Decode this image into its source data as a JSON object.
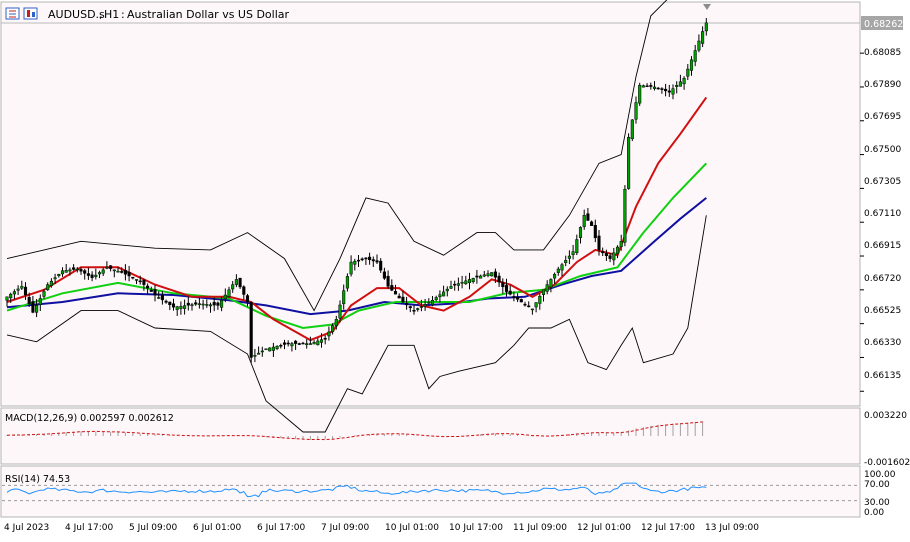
{
  "header": {
    "symbol": "AUDUSD.s",
    "timeframe": "H1",
    "description": "Australian Dollar vs US Dollar"
  },
  "colors": {
    "panel_bg": "#fdf7fa",
    "candle_up": "#00a000",
    "candle_down": "#000000",
    "bollinger": "#000000",
    "ma_fast": "#d01010",
    "ma_mid": "#10d010",
    "ma_slow": "#1010a0",
    "macd_hist": "#a0a0a0",
    "macd_signal": "#d01010",
    "rsi_line": "#1e90ff",
    "price_tag_bg": "#a6a6a6"
  },
  "icons": [
    "bars-chart-icon",
    "candles-chart-icon"
  ],
  "price_axis": {
    "current_price": "0.68262",
    "ticks": [
      "0.68085",
      "0.67890",
      "0.67695",
      "0.67500",
      "0.67305",
      "0.67110",
      "0.66915",
      "0.66720",
      "0.66525",
      "0.66330",
      "0.66135"
    ]
  },
  "time_axis": {
    "labels": [
      "4 Jul 2023",
      "4 Jul 17:00",
      "5 Jul 09:00",
      "6 Jul 01:00",
      "6 Jul 17:00",
      "7 Jul 09:00",
      "10 Jul 01:00",
      "10 Jul 17:00",
      "11 Jul 09:00",
      "12 Jul 01:00",
      "12 Jul 17:00",
      "13 Jul 09:00"
    ]
  },
  "macd": {
    "label": "MACD(12,26,9) 0.002597 0.002612",
    "ticks": [
      "0.003220",
      "-0.001602"
    ]
  },
  "rsi": {
    "label": "RSI(14) 74.53",
    "ticks": [
      "100.00",
      "70.00",
      "30.00",
      "0.00"
    ]
  },
  "chart_data": {
    "type": "candlestick",
    "ylim": [
      0.6605,
      0.6838
    ],
    "price_waypoints": [
      [
        0,
        0.6668
      ],
      [
        4,
        0.6674
      ],
      [
        7,
        0.6659
      ],
      [
        11,
        0.6675
      ],
      [
        15,
        0.6683
      ],
      [
        19,
        0.6684
      ],
      [
        23,
        0.6679
      ],
      [
        27,
        0.6685
      ],
      [
        31,
        0.6682
      ],
      [
        36,
        0.6677
      ],
      [
        40,
        0.6669
      ],
      [
        45,
        0.6662
      ],
      [
        52,
        0.6664
      ],
      [
        57,
        0.6663
      ],
      [
        62,
        0.6678
      ],
      [
        65,
        0.6665
      ],
      [
        66,
        0.6633
      ],
      [
        70,
        0.6638
      ],
      [
        76,
        0.6641
      ],
      [
        82,
        0.6641
      ],
      [
        86,
        0.6644
      ],
      [
        89,
        0.6655
      ],
      [
        93,
        0.6688
      ],
      [
        97,
        0.669
      ],
      [
        100,
        0.6688
      ],
      [
        103,
        0.6674
      ],
      [
        107,
        0.6665
      ],
      [
        110,
        0.666
      ],
      [
        115,
        0.6666
      ],
      [
        120,
        0.6674
      ],
      [
        125,
        0.6678
      ],
      [
        131,
        0.6682
      ],
      [
        135,
        0.6671
      ],
      [
        139,
        0.6665
      ],
      [
        142,
        0.6661
      ],
      [
        145,
        0.6672
      ],
      [
        149,
        0.6684
      ],
      [
        153,
        0.6694
      ],
      [
        156,
        0.6715
      ],
      [
        158,
        0.6709
      ],
      [
        160,
        0.6695
      ],
      [
        163,
        0.669
      ],
      [
        166,
        0.67
      ],
      [
        168,
        0.676
      ],
      [
        171,
        0.679
      ],
      [
        175,
        0.6789
      ],
      [
        179,
        0.6786
      ],
      [
        183,
        0.6794
      ],
      [
        186,
        0.681
      ],
      [
        188,
        0.6821
      ],
      [
        189,
        0.6826
      ]
    ],
    "bollinger_upper": [
      [
        0,
        0.669
      ],
      [
        20,
        0.67
      ],
      [
        40,
        0.6696
      ],
      [
        55,
        0.6695
      ],
      [
        65,
        0.6705
      ],
      [
        75,
        0.669
      ],
      [
        83,
        0.666
      ],
      [
        90,
        0.669
      ],
      [
        97,
        0.6725
      ],
      [
        103,
        0.6722
      ],
      [
        110,
        0.67
      ],
      [
        118,
        0.6692
      ],
      [
        127,
        0.6705
      ],
      [
        132,
        0.6705
      ],
      [
        137,
        0.6695
      ],
      [
        145,
        0.6695
      ],
      [
        152,
        0.6715
      ],
      [
        160,
        0.6745
      ],
      [
        166,
        0.675
      ],
      [
        170,
        0.6795
      ],
      [
        174,
        0.683
      ],
      [
        181,
        0.6845
      ],
      [
        189,
        0.6845
      ]
    ],
    "bollinger_lower": [
      [
        0,
        0.6646
      ],
      [
        8,
        0.6642
      ],
      [
        20,
        0.666
      ],
      [
        30,
        0.666
      ],
      [
        40,
        0.665
      ],
      [
        55,
        0.6648
      ],
      [
        65,
        0.6635
      ],
      [
        70,
        0.6608
      ],
      [
        80,
        0.659
      ],
      [
        86,
        0.659
      ],
      [
        92,
        0.6615
      ],
      [
        96,
        0.6612
      ],
      [
        103,
        0.664
      ],
      [
        110,
        0.664
      ],
      [
        114,
        0.6615
      ],
      [
        117,
        0.6622
      ],
      [
        122,
        0.6625
      ],
      [
        132,
        0.663
      ],
      [
        137,
        0.664
      ],
      [
        141,
        0.665
      ],
      [
        147,
        0.665
      ],
      [
        152,
        0.6655
      ],
      [
        157,
        0.663
      ],
      [
        162,
        0.6626
      ],
      [
        166,
        0.664
      ],
      [
        169,
        0.665
      ],
      [
        172,
        0.663
      ],
      [
        180,
        0.6635
      ],
      [
        184,
        0.665
      ],
      [
        189,
        0.6715
      ]
    ],
    "ma_fast": [
      [
        0,
        0.6665
      ],
      [
        10,
        0.6672
      ],
      [
        20,
        0.6685
      ],
      [
        30,
        0.6685
      ],
      [
        40,
        0.6675
      ],
      [
        50,
        0.6668
      ],
      [
        60,
        0.6668
      ],
      [
        66,
        0.6665
      ],
      [
        72,
        0.6655
      ],
      [
        82,
        0.6643
      ],
      [
        88,
        0.6648
      ],
      [
        93,
        0.6663
      ],
      [
        100,
        0.6673
      ],
      [
        106,
        0.6673
      ],
      [
        112,
        0.6663
      ],
      [
        118,
        0.666
      ],
      [
        125,
        0.6668
      ],
      [
        131,
        0.6678
      ],
      [
        136,
        0.6675
      ],
      [
        142,
        0.6668
      ],
      [
        148,
        0.6675
      ],
      [
        154,
        0.6688
      ],
      [
        159,
        0.6695
      ],
      [
        165,
        0.6692
      ],
      [
        170,
        0.672
      ],
      [
        176,
        0.6745
      ],
      [
        182,
        0.6762
      ],
      [
        189,
        0.6783
      ]
    ],
    "ma_mid": [
      [
        0,
        0.666
      ],
      [
        15,
        0.667
      ],
      [
        30,
        0.6676
      ],
      [
        45,
        0.667
      ],
      [
        60,
        0.6667
      ],
      [
        70,
        0.6657
      ],
      [
        80,
        0.665
      ],
      [
        88,
        0.6652
      ],
      [
        95,
        0.666
      ],
      [
        105,
        0.6665
      ],
      [
        115,
        0.6665
      ],
      [
        125,
        0.6665
      ],
      [
        135,
        0.667
      ],
      [
        145,
        0.6672
      ],
      [
        155,
        0.668
      ],
      [
        165,
        0.6685
      ],
      [
        172,
        0.6705
      ],
      [
        180,
        0.6725
      ],
      [
        189,
        0.6745
      ]
    ],
    "ma_slow": [
      [
        0,
        0.6662
      ],
      [
        15,
        0.6665
      ],
      [
        30,
        0.667
      ],
      [
        45,
        0.6669
      ],
      [
        60,
        0.6666
      ],
      [
        70,
        0.6663
      ],
      [
        82,
        0.6658
      ],
      [
        92,
        0.666
      ],
      [
        102,
        0.6665
      ],
      [
        112,
        0.6663
      ],
      [
        120,
        0.6664
      ],
      [
        130,
        0.6667
      ],
      [
        140,
        0.6668
      ],
      [
        150,
        0.6675
      ],
      [
        158,
        0.668
      ],
      [
        166,
        0.6683
      ],
      [
        175,
        0.67
      ],
      [
        182,
        0.6713
      ],
      [
        189,
        0.6725
      ]
    ]
  }
}
